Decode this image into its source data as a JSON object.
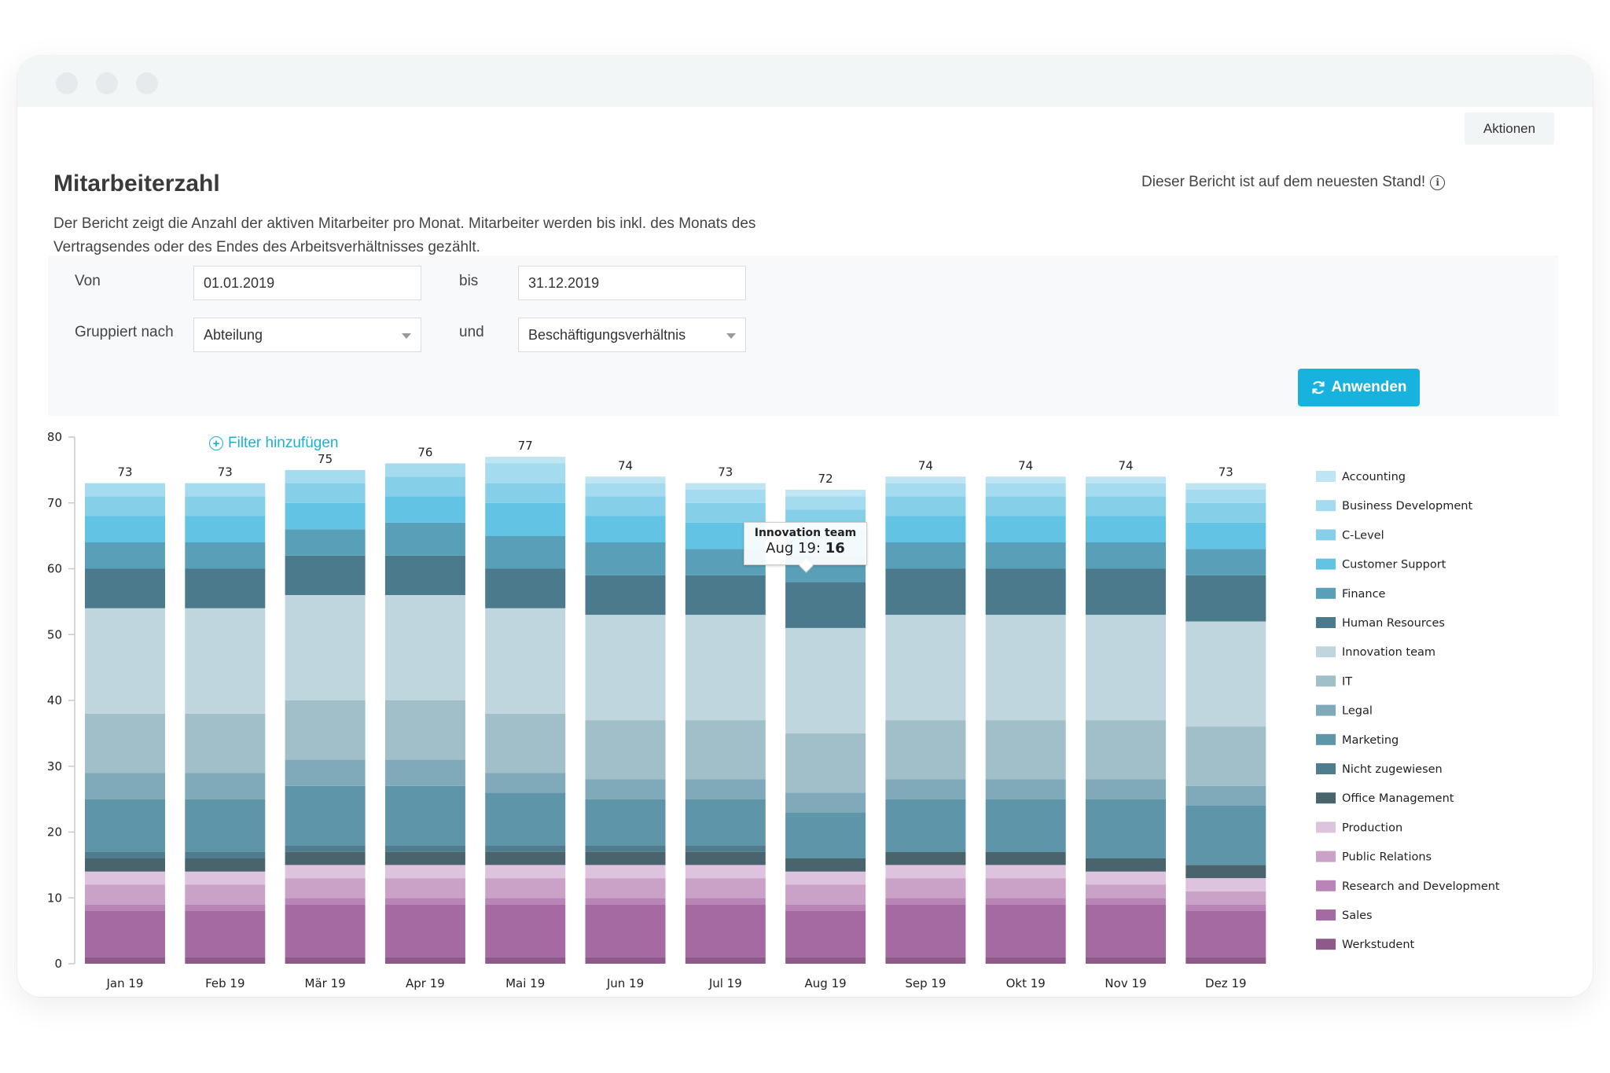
{
  "window": {
    "controls": [
      "close-dot",
      "minimize-dot",
      "maximize-dot"
    ]
  },
  "header": {
    "title": "Mitarbeiterzahl",
    "description": "Der Bericht zeigt die Anzahl der aktiven Mitarbeiter pro Monat. Mitarbeiter werden bis inkl. des Monats des Vertragsendes oder des Endes des Arbeitsverhältnisses gezählt.",
    "status_text": "Dieser Bericht ist auf dem neuesten Stand!",
    "status_icon": "info-icon",
    "actions_label": "Aktionen"
  },
  "filters": {
    "from_label": "Von",
    "from_value": "01.01.2019",
    "to_label": "bis",
    "to_value": "31.12.2019",
    "group_label": "Gruppiert nach",
    "group_value": "Abteilung",
    "and_label": "und",
    "group2_value": "Beschäftigungsverhältnis",
    "add_filter_label": "Filter hinzufügen",
    "add_filter_icon": "plus-circle-icon",
    "apply_label": "Anwenden",
    "apply_icon": "refresh-icon"
  },
  "tooltip": {
    "series": "Innovation team",
    "label": "Aug 19:",
    "value": "16"
  },
  "chart_data": {
    "type": "bar",
    "stacked": true,
    "title": "",
    "xlabel": "",
    "ylabel": "",
    "ylim": [
      0,
      80
    ],
    "yticks": [
      0,
      10,
      20,
      30,
      40,
      50,
      60,
      70,
      80
    ],
    "grid": false,
    "legend_position": "right",
    "categories": [
      "Jan 19",
      "Feb 19",
      "Mär 19",
      "Apr 19",
      "Mai 19",
      "Jun 19",
      "Jul 19",
      "Aug 19",
      "Sep 19",
      "Okt 19",
      "Nov 19",
      "Dez 19"
    ],
    "totals": [
      73,
      73,
      75,
      76,
      77,
      74,
      73,
      72,
      74,
      74,
      74,
      73
    ],
    "series": [
      {
        "name": "Accounting",
        "color": "#bfe5f2",
        "values": [
          0,
          0,
          0,
          0,
          1,
          1,
          1,
          1,
          1,
          1,
          1,
          1
        ]
      },
      {
        "name": "Business Development",
        "color": "#a5dbee",
        "values": [
          2,
          2,
          2,
          2,
          3,
          2,
          2,
          2,
          2,
          2,
          2,
          2
        ]
      },
      {
        "name": "C-Level",
        "color": "#86cfe8",
        "values": [
          3,
          3,
          3,
          3,
          3,
          3,
          3,
          3,
          3,
          3,
          3,
          3
        ]
      },
      {
        "name": "Customer Support",
        "color": "#62c3e4",
        "values": [
          4,
          4,
          4,
          4,
          5,
          4,
          4,
          4,
          4,
          4,
          4,
          4
        ]
      },
      {
        "name": "Finance",
        "color": "#589fb7",
        "values": [
          4,
          4,
          4,
          5,
          5,
          5,
          4,
          4,
          4,
          4,
          4,
          4
        ]
      },
      {
        "name": "Human Resources",
        "color": "#4a7a8b",
        "values": [
          6,
          6,
          6,
          6,
          6,
          6,
          6,
          7,
          7,
          7,
          7,
          7
        ]
      },
      {
        "name": "Innovation team",
        "color": "#c0d6df",
        "values": [
          16,
          16,
          16,
          16,
          16,
          16,
          16,
          16,
          16,
          16,
          16,
          16
        ]
      },
      {
        "name": "IT",
        "color": "#a1bfc9",
        "values": [
          9,
          9,
          9,
          9,
          9,
          9,
          9,
          9,
          9,
          9,
          9,
          9
        ]
      },
      {
        "name": "Legal",
        "color": "#80aab9",
        "values": [
          4,
          4,
          4,
          4,
          3,
          3,
          3,
          3,
          3,
          3,
          3,
          3
        ]
      },
      {
        "name": "Marketing",
        "color": "#5e95a9",
        "values": [
          8,
          8,
          9,
          9,
          8,
          7,
          7,
          7,
          8,
          8,
          9,
          9
        ]
      },
      {
        "name": "Nicht zugewiesen",
        "color": "#4f7d8d",
        "values": [
          1,
          1,
          1,
          1,
          1,
          1,
          1,
          0,
          0,
          0,
          0,
          0
        ]
      },
      {
        "name": "Office Management",
        "color": "#49646d",
        "values": [
          2,
          2,
          2,
          2,
          2,
          2,
          2,
          2,
          2,
          2,
          2,
          2
        ]
      },
      {
        "name": "Production",
        "color": "#dec3de",
        "values": [
          2,
          2,
          2,
          2,
          2,
          2,
          2,
          2,
          2,
          2,
          2,
          2
        ]
      },
      {
        "name": "Public Relations",
        "color": "#caa2c8",
        "values": [
          3,
          3,
          3,
          3,
          3,
          3,
          3,
          3,
          3,
          3,
          2,
          2
        ]
      },
      {
        "name": "Research and Development",
        "color": "#b885b6",
        "values": [
          1,
          1,
          1,
          1,
          1,
          1,
          1,
          1,
          1,
          1,
          1,
          1
        ]
      },
      {
        "name": "Sales",
        "color": "#a66aa3",
        "values": [
          7,
          7,
          8,
          8,
          8,
          8,
          8,
          7,
          8,
          8,
          8,
          7
        ]
      },
      {
        "name": "Werkstudent",
        "color": "#8d5a8a",
        "values": [
          1,
          1,
          1,
          1,
          1,
          1,
          1,
          1,
          1,
          1,
          1,
          1
        ]
      }
    ]
  }
}
